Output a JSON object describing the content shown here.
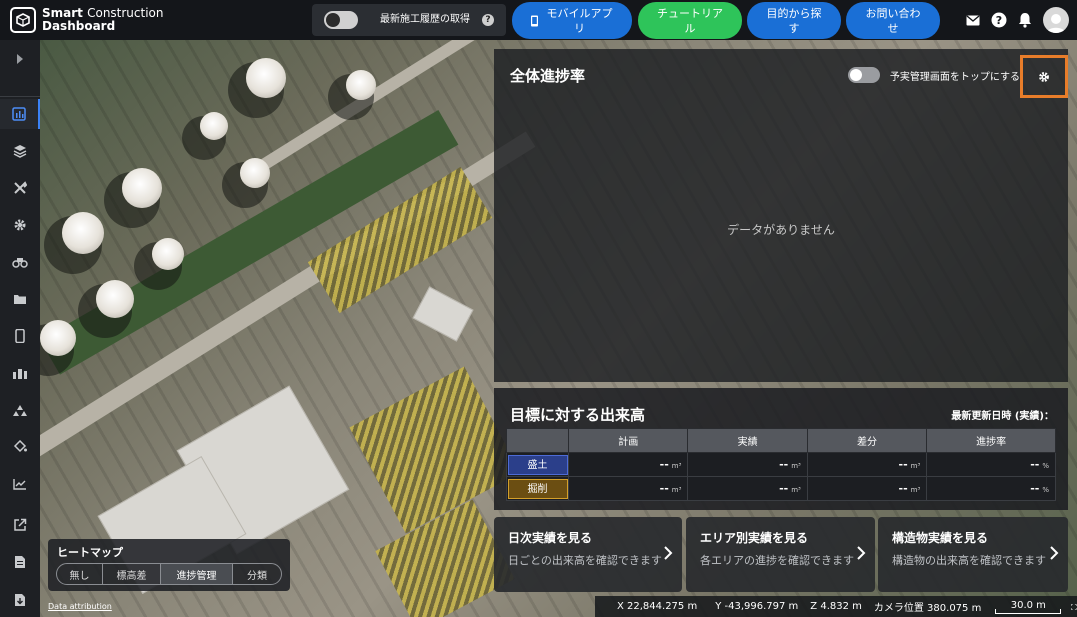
{
  "app": {
    "title_bold": "Smart",
    "title_light": "Construction",
    "title_line2": "Dashboard"
  },
  "header": {
    "history_toggle_label": "最新施工履歴の取得",
    "buttons": {
      "mobile_app": "モバイルアプリ",
      "tutorial": "チュートリアル",
      "search_by_purpose": "目的から探す",
      "contact": "お問い合わせ"
    },
    "help_glyph": "?"
  },
  "sidebar": {
    "items": [
      "expand-icon",
      "dashboard-icon",
      "layers-icon",
      "tools-icon",
      "settings-icon",
      "machinery-icon",
      "folder-icon",
      "mobile-icon",
      "survey-icon",
      "terrain-icon",
      "paint-icon",
      "chart-icon",
      "external-link-icon",
      "document-icon",
      "download-icon"
    ]
  },
  "progress_panel": {
    "title": "全体進捗率",
    "top_toggle_label": "予実管理画面をトップにする",
    "empty_message": "データがありません"
  },
  "volume_panel": {
    "title": "目標に対する出来高",
    "updated_label": "最新更新日時 (実績)：",
    "columns": [
      "計画",
      "実績",
      "差分",
      "進捗率"
    ],
    "rows": [
      {
        "label": "盛土",
        "color": "#2b3f8a",
        "border": "#4d6bd6",
        "values": [
          "--",
          "--",
          "--",
          "--"
        ],
        "units": [
          "m³",
          "m³",
          "m³",
          "%"
        ]
      },
      {
        "label": "掘削",
        "color": "#6b4e12",
        "border": "#d4a02a",
        "values": [
          "--",
          "--",
          "--",
          "--"
        ],
        "units": [
          "m³",
          "m³",
          "m³",
          "%"
        ]
      }
    ]
  },
  "cards": [
    {
      "title": "日次実績を見る",
      "desc": "日ごとの出来高を確認できます"
    },
    {
      "title": "エリア別実績を見る",
      "desc": "各エリアの進捗を確認できます"
    },
    {
      "title": "構造物実績を見る",
      "desc": "構造物の出来高を確認できます"
    }
  ],
  "heatmap": {
    "title": "ヒートマップ",
    "options": [
      "無し",
      "標高差",
      "進捗管理",
      "分類"
    ],
    "selected": "進捗管理"
  },
  "map": {
    "attribution": "Data attribution"
  },
  "status": {
    "x": "X 22,844.275 m",
    "y": "Y -43,996.797 m",
    "z": "Z 4.832 m",
    "camera": "カメラ位置 380.075 m",
    "scale": "30.0 m"
  },
  "colors": {
    "accent_blue": "#1a6fd6",
    "accent_green": "#2ec45a",
    "highlight_orange": "#e87d2a"
  }
}
